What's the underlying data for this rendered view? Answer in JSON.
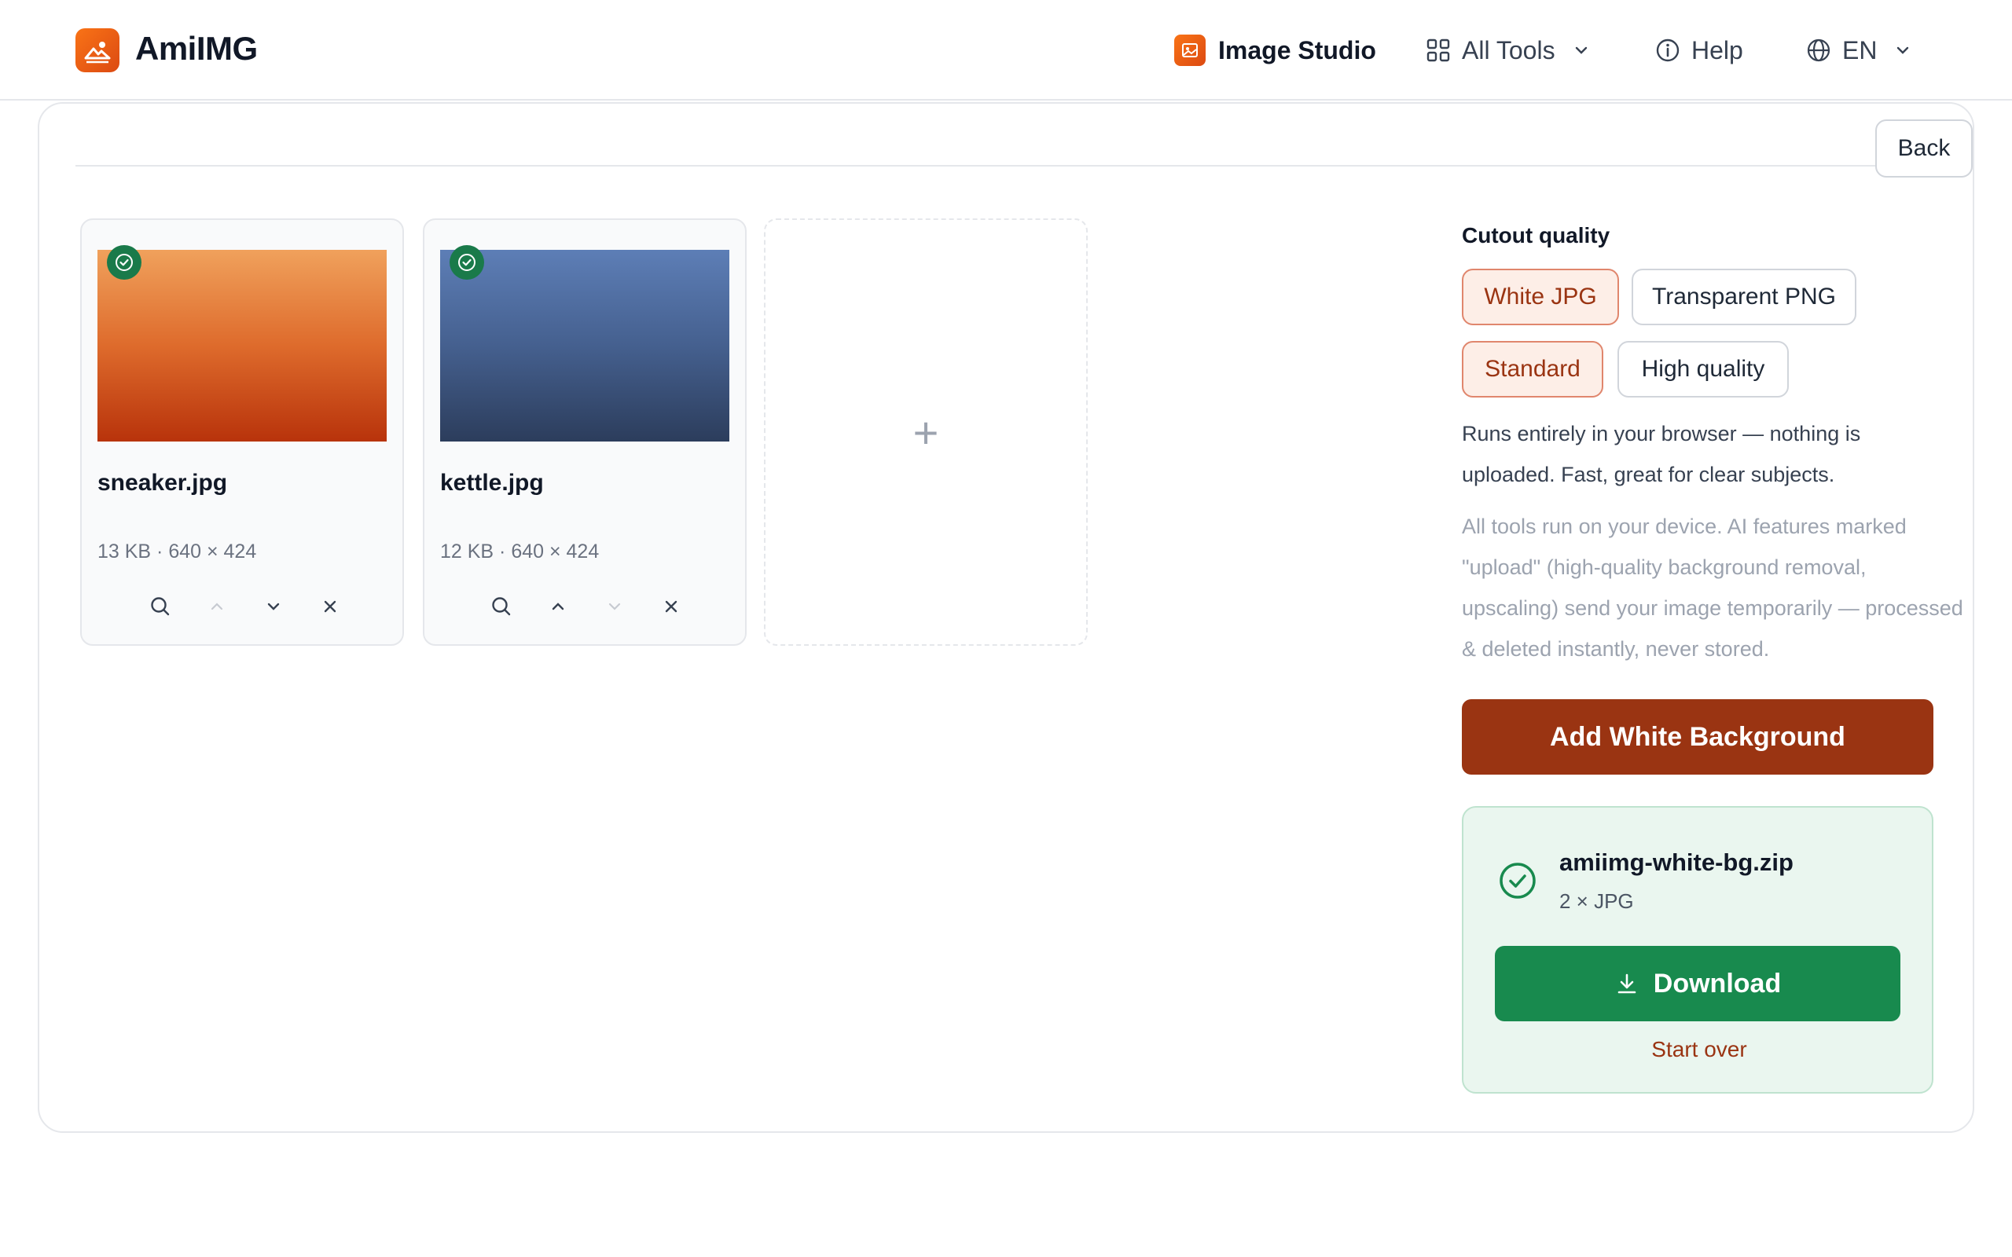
{
  "header": {
    "brand": "AmiIMG",
    "nav": {
      "studio": "Image Studio",
      "tools": "All Tools",
      "help": "Help",
      "lang": "EN"
    }
  },
  "toolbar": {
    "back_label": "Back"
  },
  "files": [
    {
      "name": "sneaker.jpg",
      "meta": "13 KB · 640 × 424",
      "status": "done"
    },
    {
      "name": "kettle.jpg",
      "meta": "12 KB · 640 × 424",
      "status": "done"
    }
  ],
  "add_tile": {
    "label": "+"
  },
  "panel": {
    "title": "Cutout quality",
    "formats": [
      "White JPG",
      "Transparent PNG"
    ],
    "selected_format": "White JPG",
    "qualities": [
      "Standard",
      "High quality"
    ],
    "selected_quality": "Standard",
    "description": "Runs entirely in your browser — nothing is uploaded. Fast, great for clear subjects.",
    "note": "All tools run on your device. AI features marked \"upload\" (high-quality background removal, upscaling) send your image temporarily — processed & deleted instantly, never stored.",
    "primary_button": "Add White Background"
  },
  "result": {
    "filename": "amiimg-white-bg.zip",
    "meta": "2 × JPG",
    "download_label": "Download",
    "start_over_label": "Start over"
  },
  "colors": {
    "accent": "#9a3412",
    "accent_bg": "#fdeee7",
    "success": "#188a4e",
    "success_bg": "#eaf6ef"
  }
}
